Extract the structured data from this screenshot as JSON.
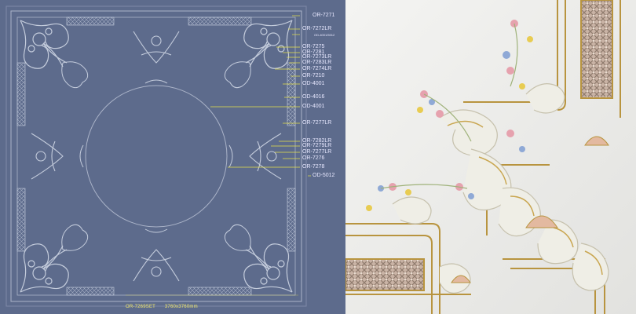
{
  "drawing": {
    "callouts": [
      {
        "code": "OR-7271",
        "tiny": false
      },
      {
        "code": "OR-7272LR",
        "tiny": false
      },
      {
        "code": "OD-4001/5012",
        "tiny": true
      },
      {
        "code": "OR-7275",
        "tiny": false
      },
      {
        "code": "OR-7281",
        "tiny": false
      },
      {
        "code": "OR-7273LR",
        "tiny": false
      },
      {
        "code": "OR-7283LR",
        "tiny": false
      },
      {
        "code": "OR-7274LR",
        "tiny": false
      },
      {
        "code": "OR-7210",
        "tiny": false
      },
      {
        "code": "OD-4001",
        "tiny": false
      },
      {
        "code": "OD-4016",
        "tiny": false
      },
      {
        "code": "OD-4001",
        "tiny": false
      },
      {
        "code": "OR-7277LR",
        "tiny": false
      },
      {
        "code": "OR-7282LR",
        "tiny": false
      },
      {
        "code": "OR-7279LR",
        "tiny": false
      },
      {
        "code": "OR-7277LR",
        "tiny": false
      },
      {
        "code": "OR-7276",
        "tiny": false
      },
      {
        "code": "OR-7278",
        "tiny": false
      },
      {
        "code": "OD-5012",
        "tiny": false
      }
    ],
    "set_code": "OR-7269SET",
    "dimensions": "3760x3760mm",
    "colors": {
      "background": "#5d6b8c",
      "ornament": "#c4ccdc",
      "leader": "#e6e04a"
    }
  },
  "photo": {
    "colors": {
      "wall": "#eeeeec",
      "gilding": "#b8943f",
      "lattice": "#b39c8c",
      "flower_pink": "#e6a2ae",
      "flower_blue": "#8fa9d6",
      "flower_yellow": "#e8cc52"
    }
  }
}
